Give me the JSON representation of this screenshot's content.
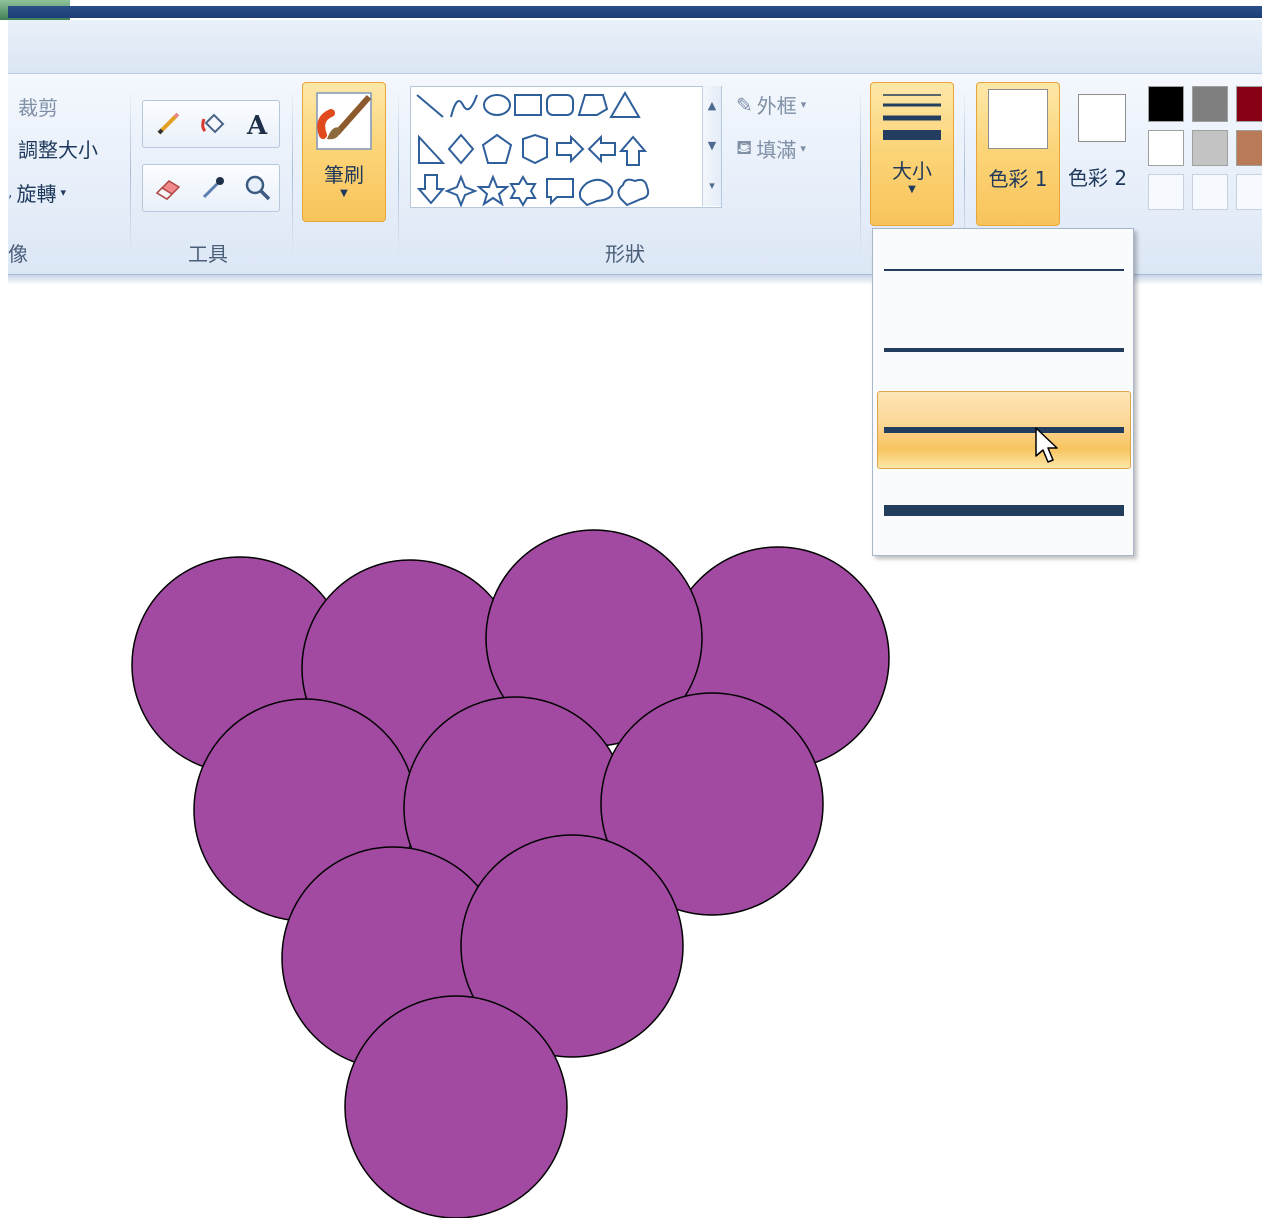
{
  "ribbon": {
    "image_group": {
      "crop_label": "裁剪",
      "resize_label": "調整大小",
      "rotate_label": "旋轉",
      "group_label": "像"
    },
    "tools_group": {
      "group_label": "工具"
    },
    "brushes": {
      "label": "筆刷"
    },
    "shapes_group": {
      "group_label": "形狀",
      "outline_label": "外框",
      "fill_label": "填滿"
    },
    "size": {
      "label": "大小"
    },
    "colors": {
      "color1_label": "色彩 1",
      "color2_label": "色彩 2",
      "palette_row1": [
        "#000000",
        "#7f7f7f",
        "#880015"
      ],
      "palette_row2": [
        "#ffffff",
        "#c3c3c3",
        "#b97a57"
      ]
    }
  },
  "size_dropdown": {
    "options": [
      {
        "name": "size-1px"
      },
      {
        "name": "size-3px"
      },
      {
        "name": "size-5px",
        "selected": true
      },
      {
        "name": "size-8px"
      }
    ]
  },
  "canvas": {
    "drawing": "grape-cluster",
    "fill_color": "#a24aa2",
    "stroke_color": "#000000"
  }
}
